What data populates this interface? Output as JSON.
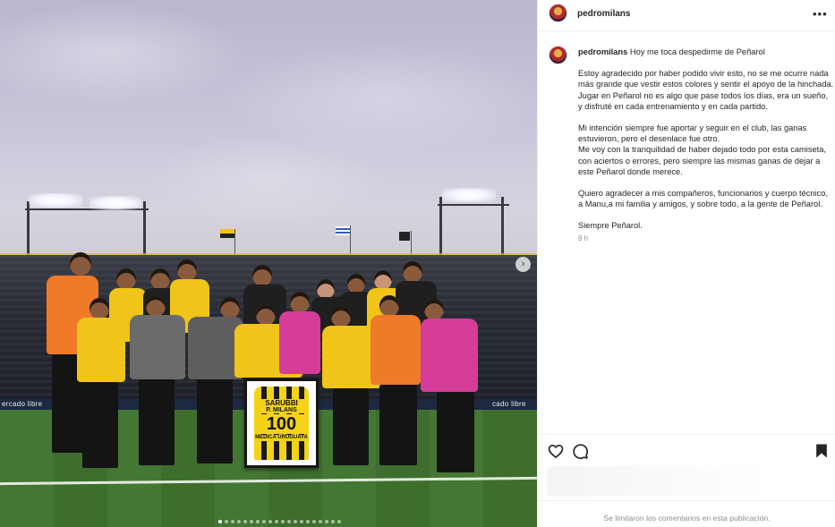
{
  "post": {
    "username": "pedromilans",
    "caption_intro": "Hoy me toca despedirme de Peñarol",
    "paragraphs": [
      "Estoy agradecido por haber podido vivir esto, no se me ocurre nada más grande que vestir estos colores y sentir el apoyo de la hinchada. Jugar en Peñarol no es algo que pase todos los días, era un sueño, y disfruté en cada entrenamiento y en cada partido.",
      "Mi intención siempre fue aportar y seguir en el club, las ganas estuvieron, pero el desenlace fue otro.",
      "Me voy con la tranquilidad de haber dejado todo por esta camiseta, con aciertos o errores, pero siempre las mismas ganas de dejar a este Peñarol donde merece.",
      "Quiero agradecer a mis compañeros, funcionarios y cuerpo técnico, a Manu,a mi familia y amigos, y sobre todo, a la gente de Peñarol.",
      "Siempre Peñarol."
    ],
    "timestamp": "9 h",
    "comments_limited": "Se limitaron los comentarios en esta publicación."
  },
  "photo": {
    "ad_text_left": "ercado libre",
    "ad_text_right": "cado libre",
    "shirt_top": "SARUBBI",
    "shirt_name": "P. MILANS",
    "shirt_number": "100",
    "shirt_sub": "MEDICA URUGUAYA",
    "carousel_total_dots": 20,
    "carousel_active_index": 0
  },
  "icons": {
    "more": "more-options-icon",
    "like": "heart-icon",
    "comment": "comment-icon",
    "save": "bookmark-icon",
    "next": "chevron-right-icon"
  },
  "colors": {
    "penarol_yellow": "#f4d317",
    "penarol_black": "#1a1a1a",
    "muted_text": "#8e8e8e"
  }
}
